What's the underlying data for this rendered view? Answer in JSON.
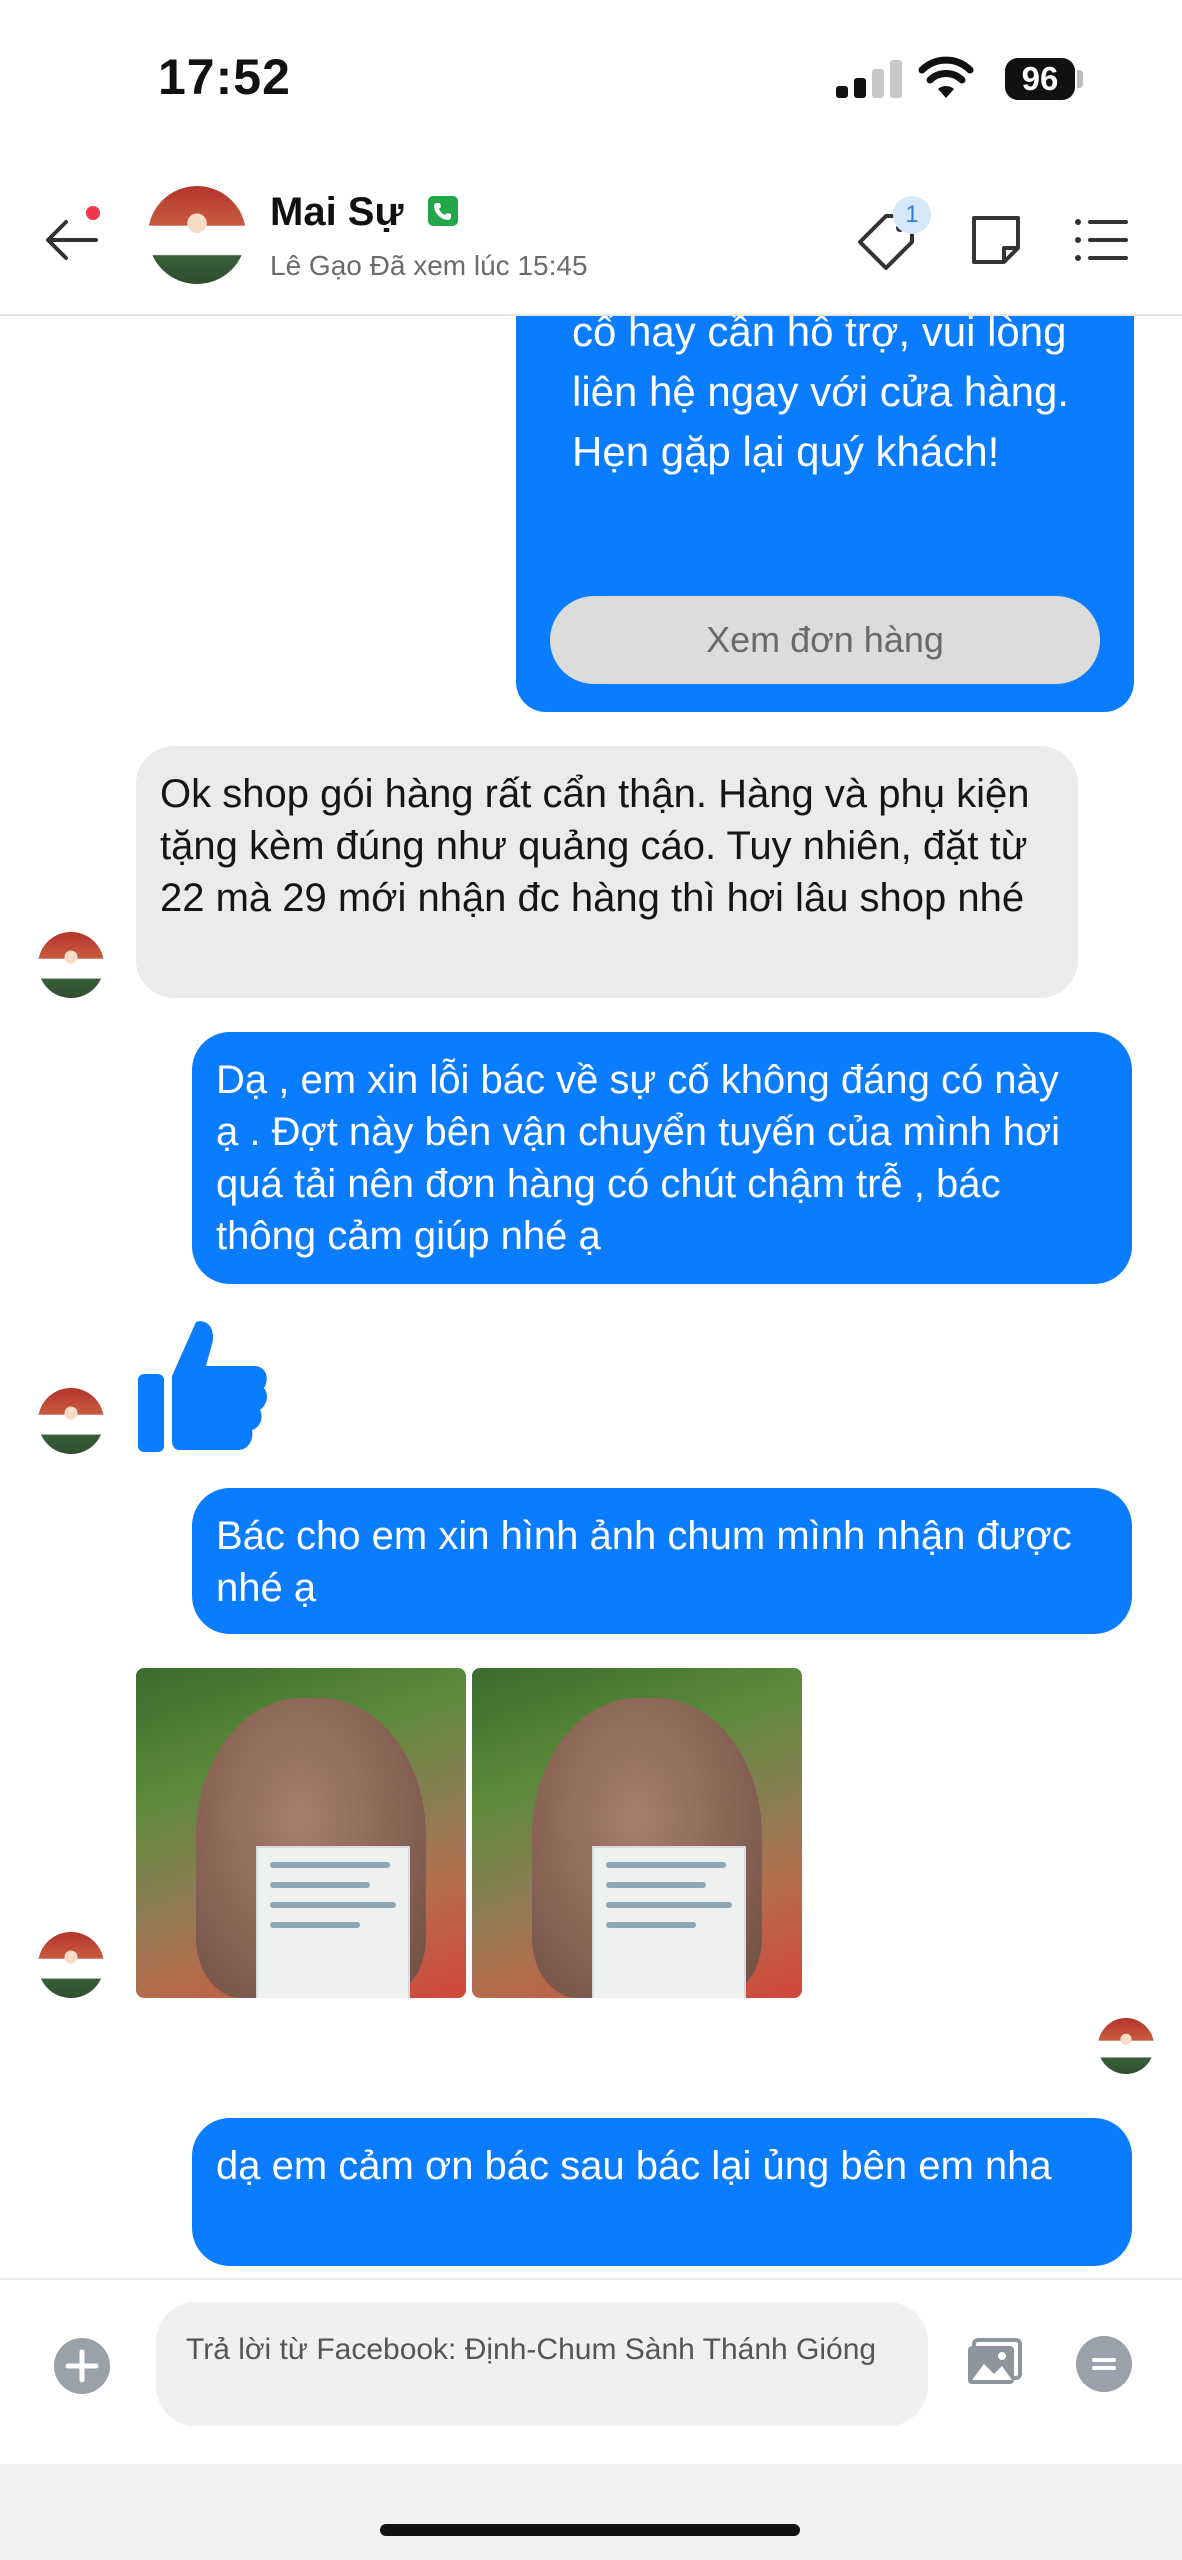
{
  "status_bar": {
    "time": "17:52",
    "battery": "96"
  },
  "header": {
    "name": "Mai Sự",
    "subtitle": "Lê Gạo Đã xem lúc 15:45",
    "tag_badge_count": "1"
  },
  "messages": {
    "order_text": "chúng tôi. Nếu bạn gặp sự cố hay cần hỗ trợ, vui lòng liên hệ ngay với cửa hàng. Hẹn gặp lại quý khách!",
    "order_button": "Xem đơn hàng",
    "m1": "Ok shop gói hàng rất cẩn thận. Hàng và phụ kiện tặng kèm đúng như quảng cáo. Tuy nhiên, đặt từ 22 mà 29 mới nhận đc hàng thì hơi lâu shop nhé",
    "m2": "Dạ , em xin lỗi bác về sự cố không đáng có này ạ . Đợt này bên vận chuyển tuyến của mình hơi quá tải nên đơn hàng có chút chậm trễ , bác thông cảm giúp nhé ạ",
    "m3": "Bác cho em xin hình ảnh chum mình nhận được nhé ạ",
    "m4": "dạ em cảm ơn bác sau bác lại ủng bên em nha"
  },
  "composer": {
    "placeholder": "Trả lời từ Facebook: Định-Chum Sành Thánh Gióng"
  },
  "colors": {
    "outgoing_bubble": "#0a7cff",
    "incoming_bubble": "#ebebeb",
    "unread_dot": "#f0384a",
    "phone_badge": "#21a64a"
  }
}
